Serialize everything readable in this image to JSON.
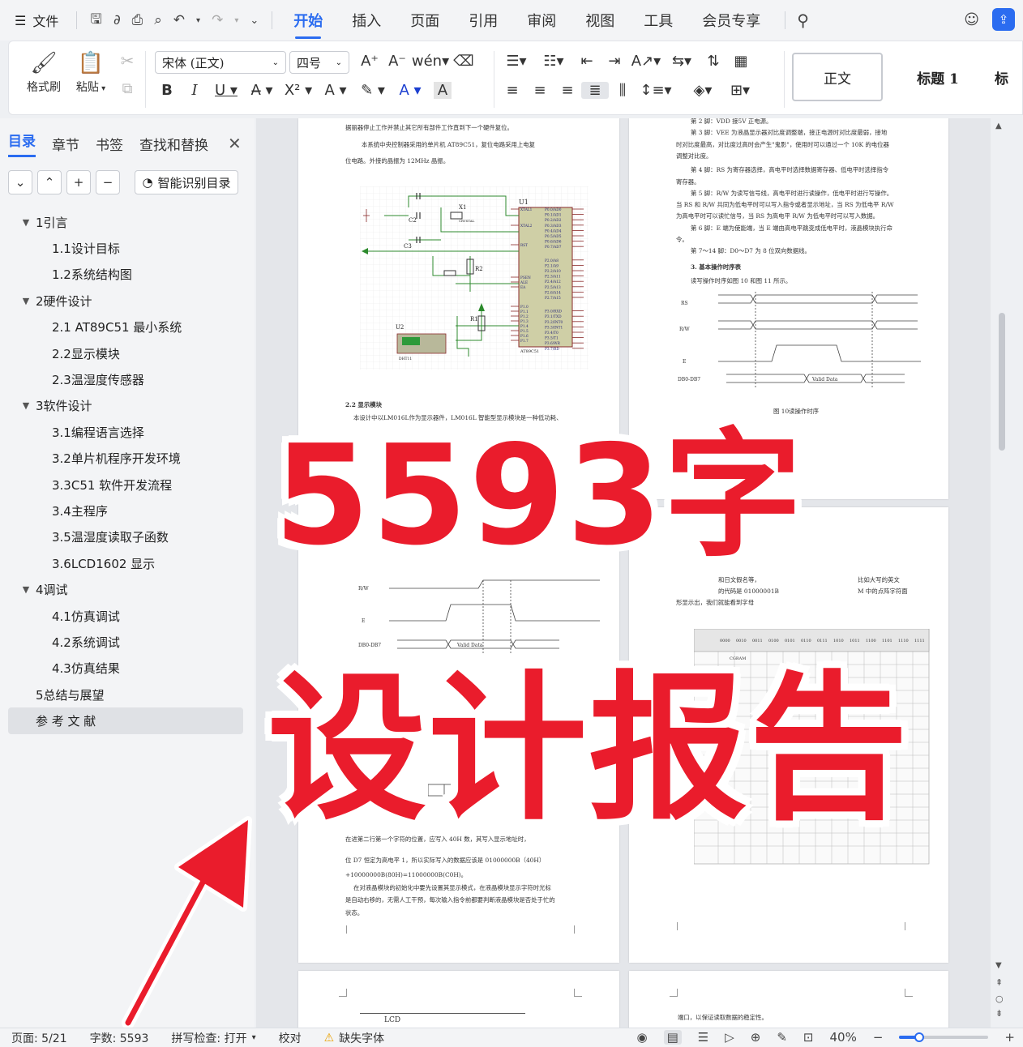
{
  "menubar": {
    "file_label": "文件",
    "tabs": [
      {
        "label": "开始",
        "active": true
      },
      {
        "label": "插入"
      },
      {
        "label": "页面"
      },
      {
        "label": "引用"
      },
      {
        "label": "审阅"
      },
      {
        "label": "视图"
      },
      {
        "label": "工具"
      },
      {
        "label": "会员专享"
      }
    ]
  },
  "ribbon": {
    "format_painter": "格式刷",
    "paste": "粘贴",
    "font_name": "宋体 (正文)",
    "font_size": "四号",
    "styles": [
      "正文",
      "标题 1",
      "标"
    ]
  },
  "navpane": {
    "tabs": [
      "目录",
      "章节",
      "书签",
      "查找和替换"
    ],
    "smart_toc": "智能识别目录",
    "toc": [
      {
        "label": "1引言",
        "level": 1,
        "expanded": true
      },
      {
        "label": "1.1设计目标",
        "level": 2
      },
      {
        "label": "1.2系统结构图",
        "level": 2
      },
      {
        "label": "2硬件设计",
        "level": 1,
        "expanded": true
      },
      {
        "label": "2.1  AT89C51 最小系统",
        "level": 2
      },
      {
        "label": "2.2显示模块",
        "level": 2
      },
      {
        "label": "2.3温湿度传感器",
        "level": 2
      },
      {
        "label": "3软件设计",
        "level": 1,
        "expanded": true
      },
      {
        "label": "3.1编程语言选择",
        "level": 2
      },
      {
        "label": "3.2单片机程序开发环境",
        "level": 2
      },
      {
        "label": "3.3C51 软件开发流程",
        "level": 2
      },
      {
        "label": "3.4主程序",
        "level": 2
      },
      {
        "label": "3.5温湿度读取子函数",
        "level": 2
      },
      {
        "label": "3.6LCD1602 显示",
        "level": 2
      },
      {
        "label": "4调试",
        "level": 1,
        "expanded": true
      },
      {
        "label": "4.1仿真调试",
        "level": 2
      },
      {
        "label": "4.2系统调试",
        "level": 2
      },
      {
        "label": "4.3仿真结果",
        "level": 2
      },
      {
        "label": "5总结与展望",
        "level": 1,
        "expanded": false
      },
      {
        "label": "参 考 文 献",
        "level": 1,
        "expanded": false,
        "selected": true
      }
    ]
  },
  "pages": {
    "p1": {
      "lines": [
        "据丽器停止工作并禁止其它所有部件工作直到下一个硬件复位。",
        "本系统中央控制器采用的单片机 AT89C51，复位电路采用上电复",
        "位电路。外接的晶振为 12MHz 晶振。"
      ],
      "section_title": "2.2  显示模块",
      "section_line": "本设计中以LM016L作为显示器件，LM016L 智能型显示模块是一种低功耗、",
      "bottom_lines": [
        "在进第二行第一个字符的位置，应写入 40H 数，其写入显示地址时，",
        "位 D7 恒定为高电平 1，所以实际写入的数据应该是 01000000B（40H）",
        "+10000000B(80H)=11000000B(C0H)。",
        "在对液晶模块的初始化中要先设置其显示模式，在液晶模块显示字符时光标",
        "是自动右移的，无需人工干预，每次输入指令前都要判断液晶模块是否处于忙的",
        "状态。"
      ],
      "chip_label": "U1",
      "chip_name": "AT89C51",
      "sensor_label": "U2",
      "sensor_name": "DHT11",
      "crystal": "CRYSTAL",
      "x1": "X1",
      "r1": "R1",
      "r2": "R2",
      "c2": "C2",
      "c3": "C3",
      "pins_left": [
        "XTAL1",
        "XTAL2",
        "RST",
        "PSEN",
        "ALE",
        "EA",
        "P1.0",
        "P1.1",
        "P1.2",
        "P1.3",
        "P1.4",
        "P1.5",
        "P1.6",
        "P1.7"
      ],
      "pins_right": [
        "P0.0/AD0",
        "P0.1/AD1",
        "P0.2/AD2",
        "P0.3/AD3",
        "P0.4/AD4",
        "P0.5/AD5",
        "P0.6/AD6",
        "P0.7/AD7",
        "P2.0/A8",
        "P2.1/A9",
        "P2.2/A10",
        "P2.3/A11",
        "P2.4/A12",
        "P2.5/A13",
        "P2.6/A14",
        "P2.7/A15",
        "P3.0/RXD",
        "P3.1/TXD",
        "P3.2/INT0",
        "P3.3/INT1",
        "P3.4/T0",
        "P3.5/T1",
        "P3.6/WR",
        "P3.7/RD"
      ],
      "timing_labels": [
        "R/W",
        "E",
        "DB0-DB7"
      ],
      "valid_data": "Valid Data"
    },
    "p2": {
      "lines": [
        "第 2 脚：VDD 接5V 正电源。",
        "第 3 脚：VEE 为液晶显示器对比度调整端，接正电源时对比度最弱，接地",
        "时对比度最高，对比度过高时会产生\"鬼影\"，使用时可以通过一个 10K 的电位器",
        "调整对比度。",
        "第 4 脚：RS 为寄存器选择，高电平时选择数据寄存器、低电平时选择指令",
        "寄存器。",
        "第 5 脚：R/W 为读写信号线，高电平时进行读操作，低电平时进行写操作。",
        "当 RS 和 R/W 共同为低电平时可以写入指令或者显示地址，当 RS 为低电平 R/W",
        "为高电平时可以读忙信号，当 RS 为高电平 R/W 为低电平时可以写入数据。",
        "第 6 脚：E 端为使能端，当 E 端由高电平跳变成低电平时，液晶模块执行命",
        "令。",
        "第 7～14 脚：D0～D7 为 8 位双向数据线。"
      ],
      "subsection": "3. 基本操作时序表",
      "subsection_line": "读写操作时序如图 10 和图 11 所示。",
      "timing_labels": [
        "RS",
        "R/W",
        "E",
        "DB0-DB7"
      ],
      "valid_data": "Valid Data",
      "caption": "图 10读操作时序",
      "lower_lines": [
        "和日文假名等，",
        "的代码是 01000001B",
        "形显示出，我们就能看到字母"
      ],
      "lower_right": [
        "比如大写的英文",
        "M 中的点阵字符面"
      ],
      "table_headers": [
        "0000",
        "0010",
        "0011",
        "0100",
        "0101",
        "0110",
        "0111",
        "1010",
        "1011",
        "1100",
        "1101",
        "1110",
        "1111"
      ],
      "cgram": "CGRAM",
      "bottom_line": "端口，以保证读取数据的稳定性。"
    },
    "p3": {
      "lcd_label": "LCD"
    }
  },
  "overlay": {
    "line1": "5593字",
    "line2": "设计报告",
    "color": "#ea1c2c"
  },
  "statusbar": {
    "page": "页面: 5/21",
    "words": "字数: 5593",
    "spell": "拼写检查: 打开",
    "proof": "校对",
    "missing_font": "缺失字体",
    "zoom": "40%",
    "zoom_level": 0.22
  }
}
